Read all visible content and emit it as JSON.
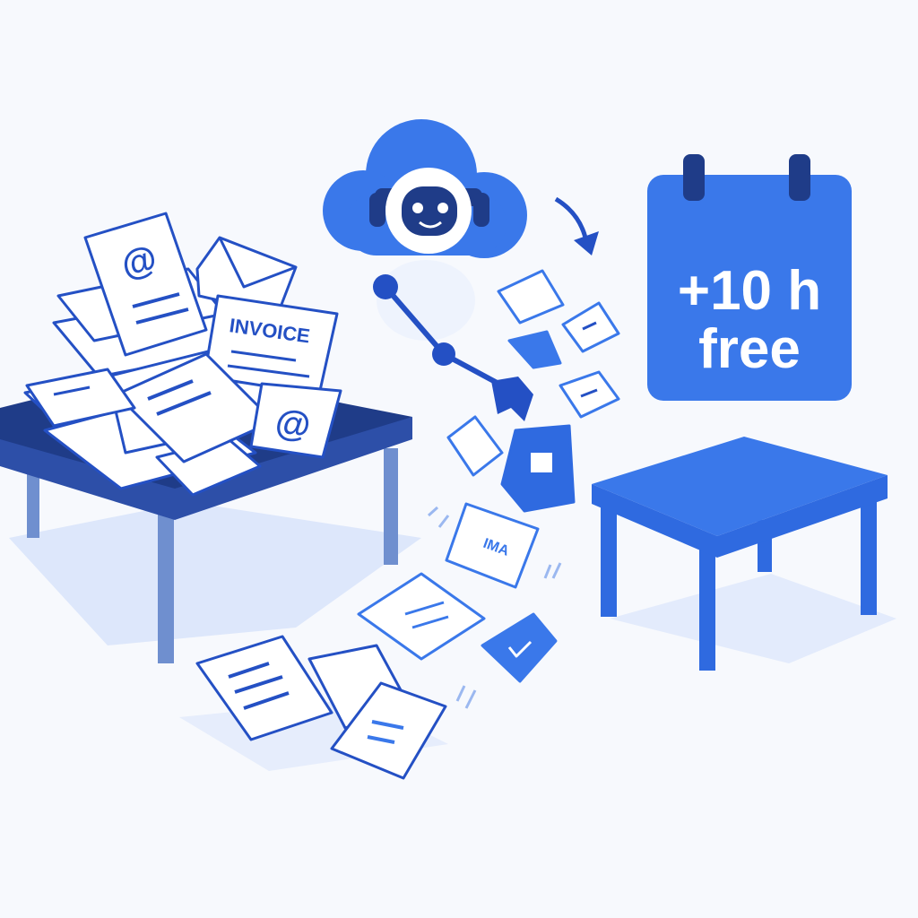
{
  "calendar": {
    "line1": "+10 h",
    "line2": "free"
  },
  "documents": {
    "invoice_label": "INVOICE",
    "at_symbol_1": "@",
    "at_symbol_2": "@",
    "flying_label": "IMA"
  },
  "colors": {
    "primary": "#3a78ea",
    "navy": "#1f3c88",
    "outline": "#2450c4",
    "shadow": "#dde7fb",
    "background": "#f7f9fd"
  },
  "icons": [
    "robot-icon",
    "cloud-icon",
    "calendar-icon",
    "envelope-icon",
    "document-icon",
    "checkmark-icon",
    "arrow-icon"
  ]
}
